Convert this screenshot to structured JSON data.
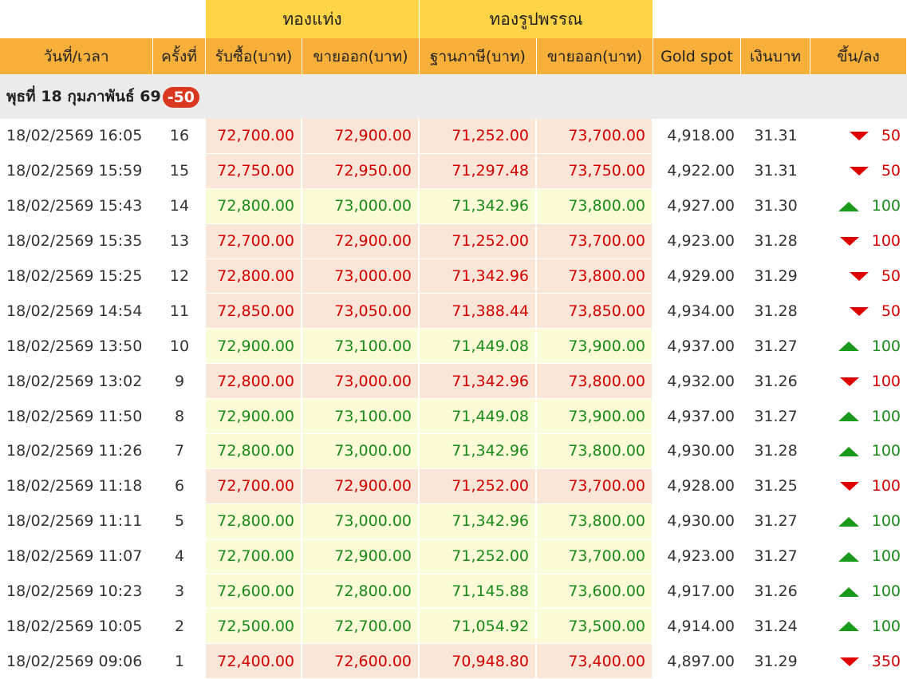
{
  "group_headers": {
    "bar": "ทองแท่ง",
    "ornament": "ทองรูปพรรณ"
  },
  "columns": {
    "datetime": "วันที่/เวลา",
    "count": "ครั้งที่",
    "bar_buy": "รับซื้อ(บาท)",
    "bar_sell": "ขายออก(บาท)",
    "orn_base": "ฐานภาษี(บาท)",
    "orn_sell": "ขายออก(บาท)",
    "gold_spot": "Gold spot",
    "thb": "เงินบาท",
    "change": "ขึ้น/ลง"
  },
  "date_header": {
    "label": "พุธที่ 18 กุมภาพันธ์ 69",
    "change": "-50"
  },
  "colors": {
    "down": "#d20000",
    "up": "#1a8a1a",
    "group": "#ffd447",
    "header": "#f9b03a",
    "badge": "#d9381e"
  },
  "rows": [
    {
      "datetime": "18/02/2569 16:05",
      "count": "16",
      "bar_buy": "72,700.00",
      "bar_sell": "72,900.00",
      "orn_base": "71,252.00",
      "orn_sell": "73,700.00",
      "spot": "4,918.00",
      "thb": "31.31",
      "dir": "down",
      "change": "50"
    },
    {
      "datetime": "18/02/2569 15:59",
      "count": "15",
      "bar_buy": "72,750.00",
      "bar_sell": "72,950.00",
      "orn_base": "71,297.48",
      "orn_sell": "73,750.00",
      "spot": "4,922.00",
      "thb": "31.31",
      "dir": "down",
      "change": "50"
    },
    {
      "datetime": "18/02/2569 15:43",
      "count": "14",
      "bar_buy": "72,800.00",
      "bar_sell": "73,000.00",
      "orn_base": "71,342.96",
      "orn_sell": "73,800.00",
      "spot": "4,927.00",
      "thb": "31.30",
      "dir": "up",
      "change": "100"
    },
    {
      "datetime": "18/02/2569 15:35",
      "count": "13",
      "bar_buy": "72,700.00",
      "bar_sell": "72,900.00",
      "orn_base": "71,252.00",
      "orn_sell": "73,700.00",
      "spot": "4,923.00",
      "thb": "31.28",
      "dir": "down",
      "change": "100"
    },
    {
      "datetime": "18/02/2569 15:25",
      "count": "12",
      "bar_buy": "72,800.00",
      "bar_sell": "73,000.00",
      "orn_base": "71,342.96",
      "orn_sell": "73,800.00",
      "spot": "4,929.00",
      "thb": "31.29",
      "dir": "down",
      "change": "50"
    },
    {
      "datetime": "18/02/2569 14:54",
      "count": "11",
      "bar_buy": "72,850.00",
      "bar_sell": "73,050.00",
      "orn_base": "71,388.44",
      "orn_sell": "73,850.00",
      "spot": "4,934.00",
      "thb": "31.28",
      "dir": "down",
      "change": "50"
    },
    {
      "datetime": "18/02/2569 13:50",
      "count": "10",
      "bar_buy": "72,900.00",
      "bar_sell": "73,100.00",
      "orn_base": "71,449.08",
      "orn_sell": "73,900.00",
      "spot": "4,937.00",
      "thb": "31.27",
      "dir": "up",
      "change": "100"
    },
    {
      "datetime": "18/02/2569 13:02",
      "count": "9",
      "bar_buy": "72,800.00",
      "bar_sell": "73,000.00",
      "orn_base": "71,342.96",
      "orn_sell": "73,800.00",
      "spot": "4,932.00",
      "thb": "31.26",
      "dir": "down",
      "change": "100"
    },
    {
      "datetime": "18/02/2569 11:50",
      "count": "8",
      "bar_buy": "72,900.00",
      "bar_sell": "73,100.00",
      "orn_base": "71,449.08",
      "orn_sell": "73,900.00",
      "spot": "4,937.00",
      "thb": "31.27",
      "dir": "up",
      "change": "100"
    },
    {
      "datetime": "18/02/2569 11:26",
      "count": "7",
      "bar_buy": "72,800.00",
      "bar_sell": "73,000.00",
      "orn_base": "71,342.96",
      "orn_sell": "73,800.00",
      "spot": "4,930.00",
      "thb": "31.28",
      "dir": "up",
      "change": "100"
    },
    {
      "datetime": "18/02/2569 11:18",
      "count": "6",
      "bar_buy": "72,700.00",
      "bar_sell": "72,900.00",
      "orn_base": "71,252.00",
      "orn_sell": "73,700.00",
      "spot": "4,928.00",
      "thb": "31.25",
      "dir": "down",
      "change": "100"
    },
    {
      "datetime": "18/02/2569 11:11",
      "count": "5",
      "bar_buy": "72,800.00",
      "bar_sell": "73,000.00",
      "orn_base": "71,342.96",
      "orn_sell": "73,800.00",
      "spot": "4,930.00",
      "thb": "31.27",
      "dir": "up",
      "change": "100"
    },
    {
      "datetime": "18/02/2569 11:07",
      "count": "4",
      "bar_buy": "72,700.00",
      "bar_sell": "72,900.00",
      "orn_base": "71,252.00",
      "orn_sell": "73,700.00",
      "spot": "4,923.00",
      "thb": "31.27",
      "dir": "up",
      "change": "100"
    },
    {
      "datetime": "18/02/2569 10:23",
      "count": "3",
      "bar_buy": "72,600.00",
      "bar_sell": "72,800.00",
      "orn_base": "71,145.88",
      "orn_sell": "73,600.00",
      "spot": "4,917.00",
      "thb": "31.26",
      "dir": "up",
      "change": "100"
    },
    {
      "datetime": "18/02/2569 10:05",
      "count": "2",
      "bar_buy": "72,500.00",
      "bar_sell": "72,700.00",
      "orn_base": "71,054.92",
      "orn_sell": "73,500.00",
      "spot": "4,914.00",
      "thb": "31.24",
      "dir": "up",
      "change": "100"
    },
    {
      "datetime": "18/02/2569 09:06",
      "count": "1",
      "bar_buy": "72,400.00",
      "bar_sell": "72,600.00",
      "orn_base": "70,948.80",
      "orn_sell": "73,400.00",
      "spot": "4,897.00",
      "thb": "31.29",
      "dir": "down",
      "change": "350"
    }
  ]
}
